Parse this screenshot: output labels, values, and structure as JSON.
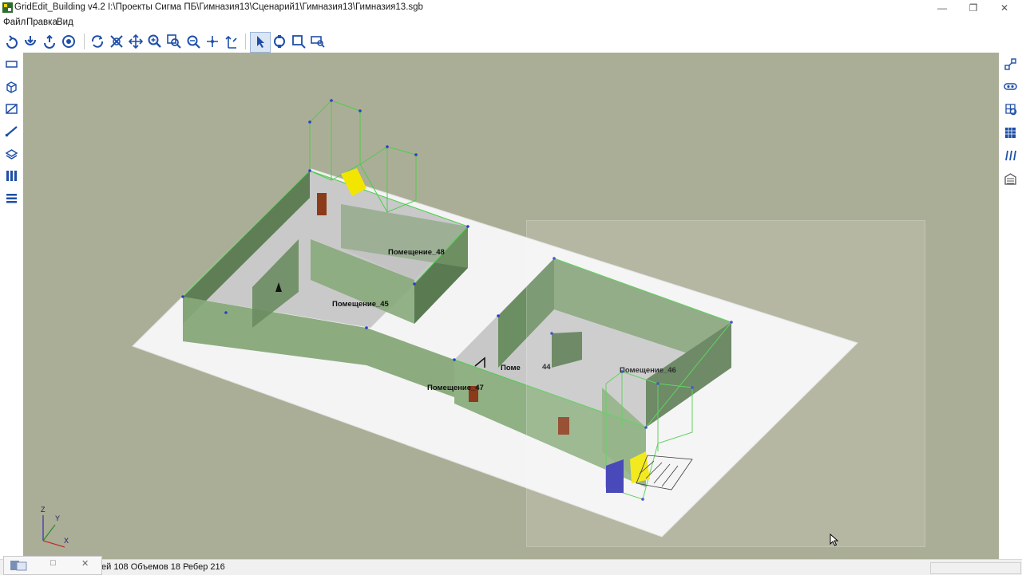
{
  "window": {
    "title": "GridEdit_Building v4.2 I:\\Проекты Сигма ПБ\\Гимназия13\\Сценарий1\\Гимназия13\\Гимназия13.sgb",
    "controls": {
      "minimize": "—",
      "restore": "❐",
      "close": "✕"
    }
  },
  "menu": {
    "items": [
      "Файл",
      "Правка",
      "Вид"
    ]
  },
  "toolbar": {
    "buttons": [
      "rotate-left-icon",
      "rotate-down-icon",
      "rotate-up-icon",
      "orbit-icon",
      "refresh-icon",
      "zoom-fit-icon",
      "pan-icon",
      "zoom-in-icon",
      "zoom-window-icon",
      "zoom-all-icon",
      "move-axes-icon",
      "axis-up-icon",
      "select-arrow-icon",
      "select-node-icon",
      "select-area-icon",
      "select-filter-icon"
    ]
  },
  "left_tools": [
    "rectangle-icon",
    "volume-icon",
    "room-icon",
    "edge-icon",
    "layers-icon",
    "stairs-icon",
    "floors-icon"
  ],
  "right_tools": [
    "connect-icon",
    "link-icon",
    "mesh-icon",
    "grid-icon",
    "flow-icon",
    "building-icon"
  ],
  "scene": {
    "room_labels": [
      "Помещение_48",
      "Помещение_45",
      "Помещение_47",
      "Поме",
      "44",
      "Помещение_46"
    ],
    "axes": {
      "z": "Z",
      "y": "Y",
      "x": "X"
    },
    "colors": {
      "background": "#abae96",
      "wall": "#6a8f5f",
      "floor": "#c8c8c8",
      "door": "#8b3a1a",
      "highlight": "#f2e600",
      "selected": "#3030b0"
    }
  },
  "status": {
    "text": "ей 108 Объемов 18 Ребер 216"
  },
  "taskbar_thumb": {
    "maximize": "□",
    "close": "✕"
  }
}
